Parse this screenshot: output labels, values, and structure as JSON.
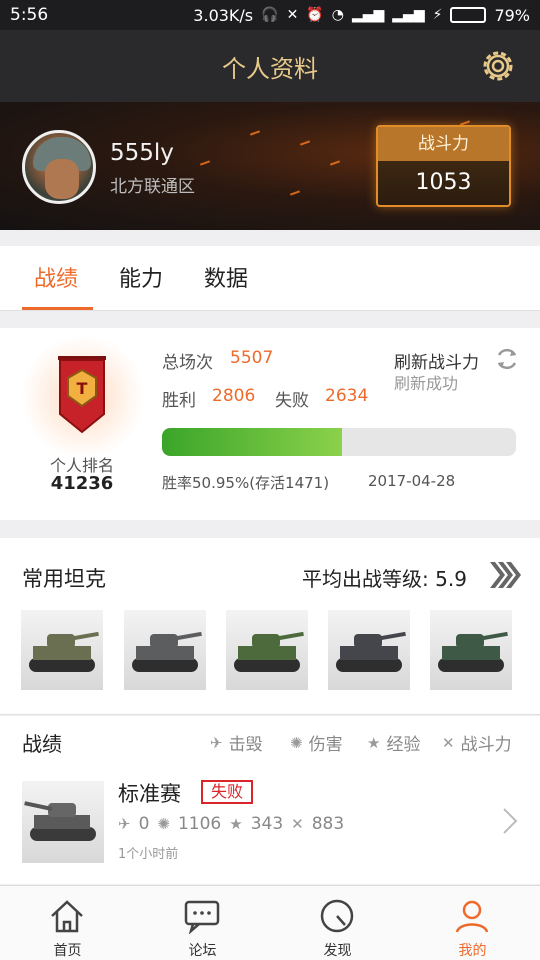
{
  "status_bar": {
    "time": "5:56",
    "speed": "3.03K/s",
    "battery": "79%",
    "battery_level": 0.79
  },
  "header": {
    "title": "个人资料",
    "settings_icon": "gear-icon"
  },
  "profile": {
    "username": "555ly",
    "region": "北方联通区",
    "power_label": "战斗力",
    "power_value": "1053"
  },
  "tabs": [
    {
      "label": "战绩",
      "active": true
    },
    {
      "label": "能力",
      "active": false
    },
    {
      "label": "数据",
      "active": false
    }
  ],
  "stats": {
    "rank_label": "个人排名",
    "rank_value": "41236",
    "total_label": "总场次",
    "total_value": "5507",
    "win_label": "胜利",
    "win_value": "2806",
    "loss_label": "失败",
    "loss_value": "2634",
    "refresh_label": "刷新战斗力",
    "refresh_status": "刷新成功",
    "win_rate_fraction": 0.5095,
    "win_rate_text": "胜率50.95%(存活1471)",
    "date": "2017-04-28"
  },
  "tanks_section": {
    "title": "常用坦克",
    "avg_label": "平均出战等级:",
    "avg_value": "5.9"
  },
  "tanks": [
    {
      "color": "#6b6f52"
    },
    {
      "color": "#5b5d5e"
    },
    {
      "color": "#4d6a3c"
    },
    {
      "color": "#44464c"
    },
    {
      "color": "#3e5a46"
    }
  ],
  "battles_section": {
    "title": "战绩",
    "legend": [
      {
        "icon": "kill-icon",
        "label": "击毁"
      },
      {
        "icon": "damage-icon",
        "label": "伤害"
      },
      {
        "icon": "star-icon",
        "label": "经验"
      },
      {
        "icon": "power-icon",
        "label": "战斗力"
      }
    ]
  },
  "battle": {
    "mode": "标准赛",
    "result": "失败",
    "kills": "0",
    "damage": "1106",
    "exp": "343",
    "power": "883",
    "time": "1个小时前"
  },
  "nav": [
    {
      "label": "首页",
      "icon": "home-icon"
    },
    {
      "label": "论坛",
      "icon": "forum-icon"
    },
    {
      "label": "发现",
      "icon": "discover-icon"
    },
    {
      "label": "我的",
      "icon": "user-icon",
      "active": true
    }
  ],
  "colors": {
    "accent": "#ee6a2a",
    "loss": "#d8262a",
    "bar_start": "#3aa52a",
    "bar_end": "#8bd14a"
  }
}
